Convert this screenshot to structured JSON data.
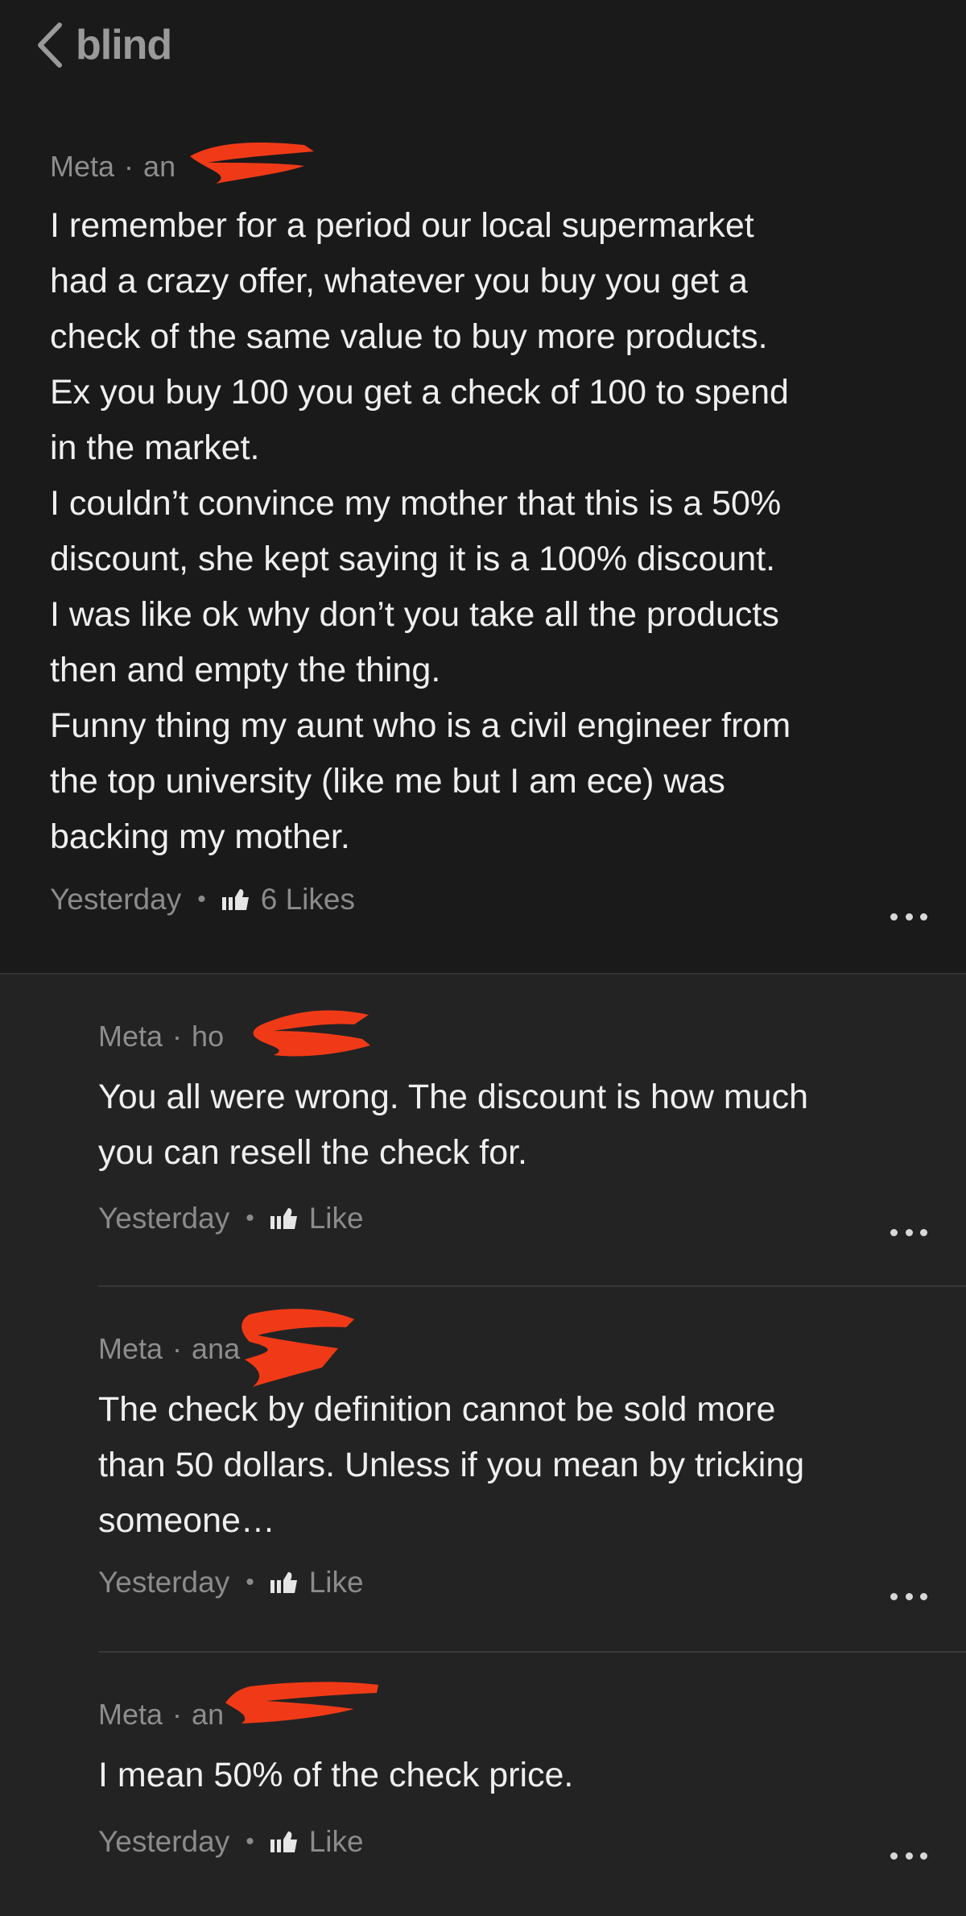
{
  "app": {
    "brand": "blind",
    "back_icon": "chevron-left-icon"
  },
  "post": {
    "company": "Meta",
    "username_visible": "an",
    "separator": "·",
    "body": "I remember for a period our local supermarket\nhad a crazy offer, whatever you buy you get a\ncheck of the same value to buy more products.\nEx you buy 100 you get a check of 100 to spend\nin the market.\nI couldn’t convince my mother that this is a 50%\ndiscount, she kept saying it is a 100% discount.\nI was like ok why don’t you take all the products\nthen and empty the thing.\nFunny thing my aunt who is a civil engineer from\nthe top university (like me but I am ece) was\nbacking my mother.",
    "time": "Yesterday",
    "likes_label": "6 Likes"
  },
  "replies": [
    {
      "company": "Meta",
      "username_visible": "ho",
      "separator": "·",
      "body": "You all were wrong. The discount is how much\nyou can resell the check for.",
      "time": "Yesterday",
      "like_label": "Like"
    },
    {
      "company": "Meta",
      "username_visible": "ana",
      "separator": "·",
      "body": "The check by definition cannot be sold more\nthan 50 dollars. Unless if you mean by tricking\nsomeone…",
      "time": "Yesterday",
      "like_label": "Like"
    },
    {
      "company": "Meta",
      "username_visible": "an",
      "separator": "·",
      "body": "I mean 50% of the check price.",
      "time": "Yesterday",
      "like_label": "Like"
    }
  ],
  "colors": {
    "background": "#232323",
    "post_background": "#1a1a1a",
    "redaction": "#f03a17",
    "muted_text": "#8d8d8d",
    "body_text": "#efefef"
  }
}
